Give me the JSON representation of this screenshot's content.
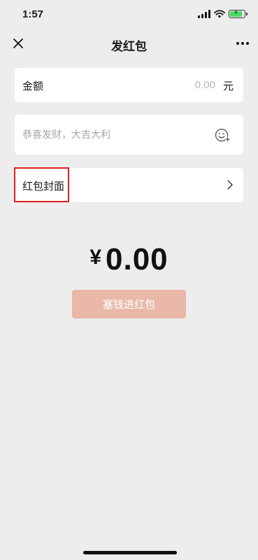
{
  "status_bar": {
    "time": "1:57",
    "icons": [
      "signal-icon",
      "wifi-icon",
      "battery-charging-icon"
    ],
    "battery_fill_fraction": 0.85
  },
  "nav": {
    "title": "发红包",
    "left_icon": "close-icon",
    "right_icon": "more-icon"
  },
  "amount": {
    "label": "金额",
    "value": "0.00",
    "unit": "元"
  },
  "greeting": {
    "placeholder": "恭喜发财，大吉大利",
    "icon": "emoji-add-icon"
  },
  "cover": {
    "label": "红包封面",
    "icon": "chevron-right-icon",
    "highlight_color": "#e01f1f"
  },
  "total": {
    "currency_symbol": "¥",
    "value": "0.00"
  },
  "submit": {
    "label": "塞钱进红包",
    "color": "#e9b8a9"
  }
}
